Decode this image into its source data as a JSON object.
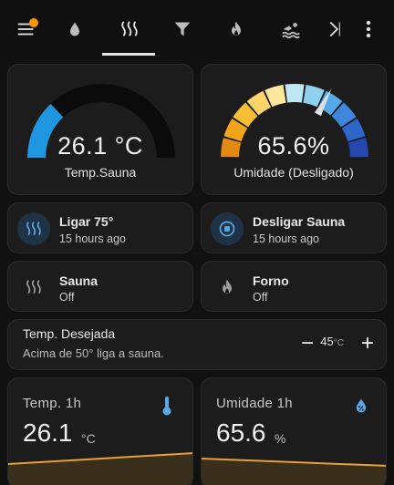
{
  "toolbar": {
    "tabs": [
      {
        "name": "menu",
        "icon": "menu-icon",
        "active": false
      },
      {
        "name": "water",
        "icon": "water-drop-icon",
        "active": false
      },
      {
        "name": "sauna",
        "icon": "heat-waves-icon",
        "active": true
      },
      {
        "name": "filter",
        "icon": "filter-icon",
        "active": false
      },
      {
        "name": "fire",
        "icon": "fire-icon",
        "active": false
      },
      {
        "name": "pool",
        "icon": "swimmer-icon",
        "active": false
      }
    ],
    "badge_color": "#ff9800"
  },
  "gauges": {
    "temp": {
      "value": "26.1 °C",
      "label": "Temp.Sauna",
      "level": 0.26,
      "color": "#1e96e0"
    },
    "humidity": {
      "value": "65.6%",
      "label": "Umidade (Desligado)",
      "level": 0.656
    }
  },
  "buttons": {
    "on": {
      "title": "Ligar 75°",
      "sub": "15 hours ago",
      "icon": "heat-waves-icon"
    },
    "off": {
      "title": "Desligar Sauna",
      "sub": "15 hours ago",
      "icon": "stop-circle-icon"
    }
  },
  "tiles": {
    "sauna": {
      "title": "Sauna",
      "state": "Off",
      "icon": "heat-waves-icon"
    },
    "forno": {
      "title": "Forno",
      "state": "Off",
      "icon": "fire-icon"
    }
  },
  "setpoint": {
    "title": "Temp. Desejada",
    "subtitle": "Acima de 50° liga a sauna.",
    "value": "45",
    "unit": "°C",
    "minus": "−",
    "plus": "+"
  },
  "sensors": {
    "temp": {
      "name": "Temp. 1h",
      "value": "26.1",
      "unit": "°C",
      "icon": "thermometer-icon",
      "color": "#e8a13a"
    },
    "humidity": {
      "name": "Umidade 1h",
      "value": "65.6",
      "unit": "%",
      "icon": "water-percent-icon",
      "color": "#e8a13a"
    }
  },
  "colors": {
    "accent": "#5aa8e6",
    "card": "#1c1c1c",
    "background": "#111111"
  }
}
